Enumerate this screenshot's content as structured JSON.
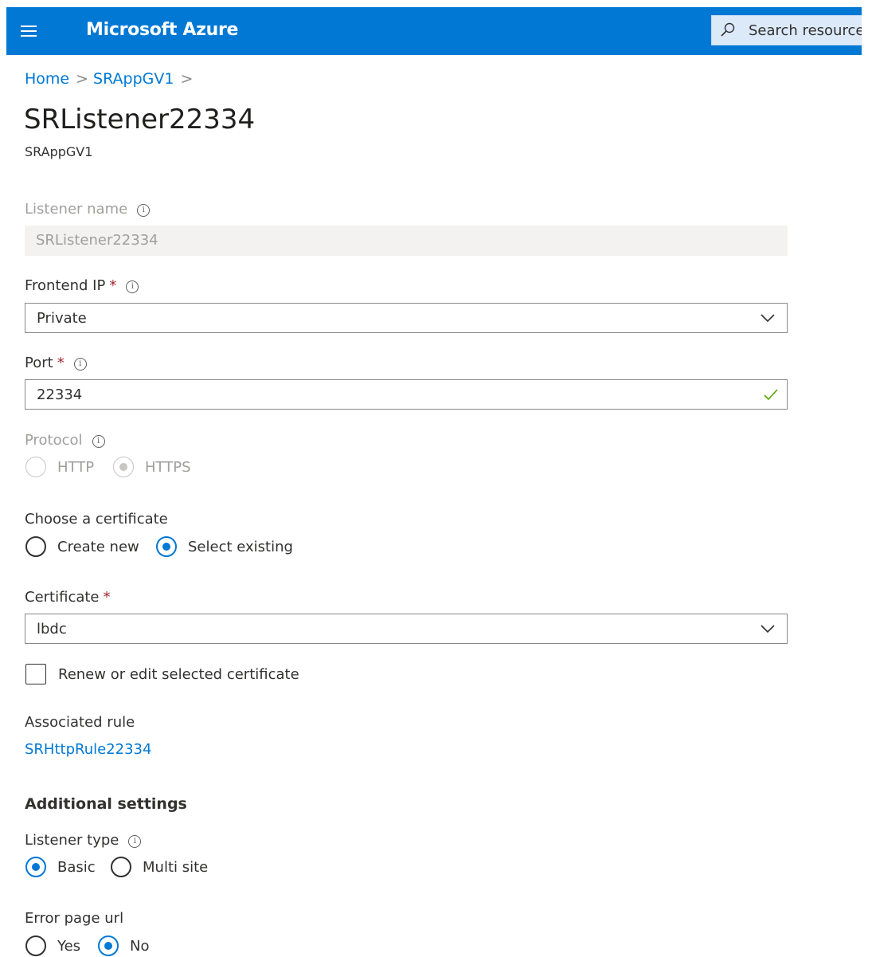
{
  "header": {
    "app_title": "Microsoft Azure",
    "search_placeholder": "Search resources"
  },
  "breadcrumb": {
    "items": [
      "Home",
      "SRAppGV1"
    ],
    "separator": ">"
  },
  "page": {
    "title": "SRListener22334",
    "subtitle": "SRAppGV1"
  },
  "form": {
    "listener_name": {
      "label": "Listener name",
      "value": "SRListener22334"
    },
    "frontend_ip": {
      "label": "Frontend IP",
      "value": "Private"
    },
    "port": {
      "label": "Port",
      "value": "22334"
    },
    "protocol": {
      "label": "Protocol",
      "options": [
        "HTTP",
        "HTTPS"
      ],
      "selected": "HTTPS"
    },
    "certificate_choice": {
      "label": "Choose a certificate",
      "options": [
        "Create new",
        "Select existing"
      ],
      "selected": "Select existing"
    },
    "certificate": {
      "label": "Certificate",
      "value": "lbdc"
    },
    "renew_checkbox": {
      "label": "Renew or edit selected certificate",
      "checked": false
    },
    "associated_rule": {
      "label": "Associated rule",
      "link": "SRHttpRule22334"
    },
    "additional_settings": {
      "heading": "Additional settings"
    },
    "listener_type": {
      "label": "Listener type",
      "options": [
        "Basic",
        "Multi site"
      ],
      "selected": "Basic"
    },
    "error_page_url": {
      "label": "Error page url",
      "options": [
        "Yes",
        "No"
      ],
      "selected": "No"
    }
  },
  "required_marker": "*",
  "info_glyph": "i",
  "colors": {
    "accent": "#0078d4",
    "required": "#a4262c",
    "valid": "#57a300"
  }
}
